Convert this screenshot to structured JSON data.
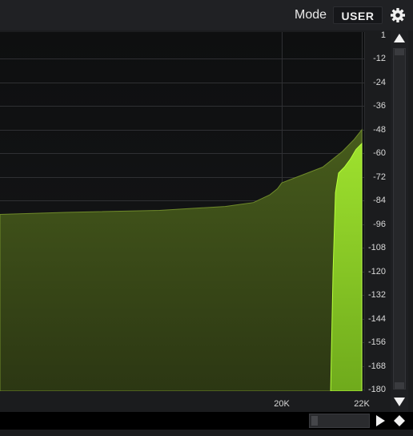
{
  "topbar": {
    "mode_label": "Mode",
    "mode_value": "USER",
    "settings_icon": "gear-icon"
  },
  "colors": {
    "background": "#1b1c1e",
    "plot_background": "#111214",
    "grid": "#2f3033",
    "spectrum_fill": "#3a4a16",
    "spectrum_line": "#6f8a2a",
    "peak_fill": "#8fcf2a",
    "peak_line": "#b6ff3a"
  },
  "chart_data": {
    "type": "area",
    "x_scale": "log",
    "xlim": [
      20,
      22000
    ],
    "ylim": [
      -180,
      0
    ],
    "x_tick_labels": [
      "20K",
      "22K"
    ],
    "x_tick_values": [
      20000,
      22000
    ],
    "y_tick_labels": [
      "1",
      "-12",
      "-24",
      "-36",
      "-48",
      "-60",
      "-72",
      "-84",
      "-96",
      "-108",
      "-120",
      "-132",
      "-144",
      "-156",
      "-168",
      "-180"
    ],
    "y_tick_values": [
      0,
      -12,
      -24,
      -36,
      -48,
      -60,
      -72,
      -84,
      -96,
      -108,
      -120,
      -132,
      -144,
      -156,
      -168,
      -180
    ],
    "series": [
      {
        "style": "filled-area",
        "x": [
          20,
          100,
          1000,
          5000,
          10000,
          15000,
          18000,
          20000,
          21000,
          21500,
          21800,
          22000
        ],
        "y": [
          -91,
          -90,
          -89,
          -87,
          -85,
          -81,
          -78,
          -75,
          -67,
          -59,
          -53,
          -48
        ]
      },
      {
        "style": "filled-area-bright",
        "x": [
          21200,
          21260,
          21320,
          21400,
          21550,
          21700,
          21850,
          22000
        ],
        "y": [
          -180,
          -120,
          -80,
          -70,
          -67,
          -63,
          -58,
          -55
        ]
      }
    ]
  },
  "scrollbars": {
    "vertical_up_icon": "triangle-up-icon",
    "vertical_down_icon": "triangle-down-icon",
    "horizontal_right_icon": "play-right-icon",
    "zoom_reset_icon": "diamond-icon"
  }
}
